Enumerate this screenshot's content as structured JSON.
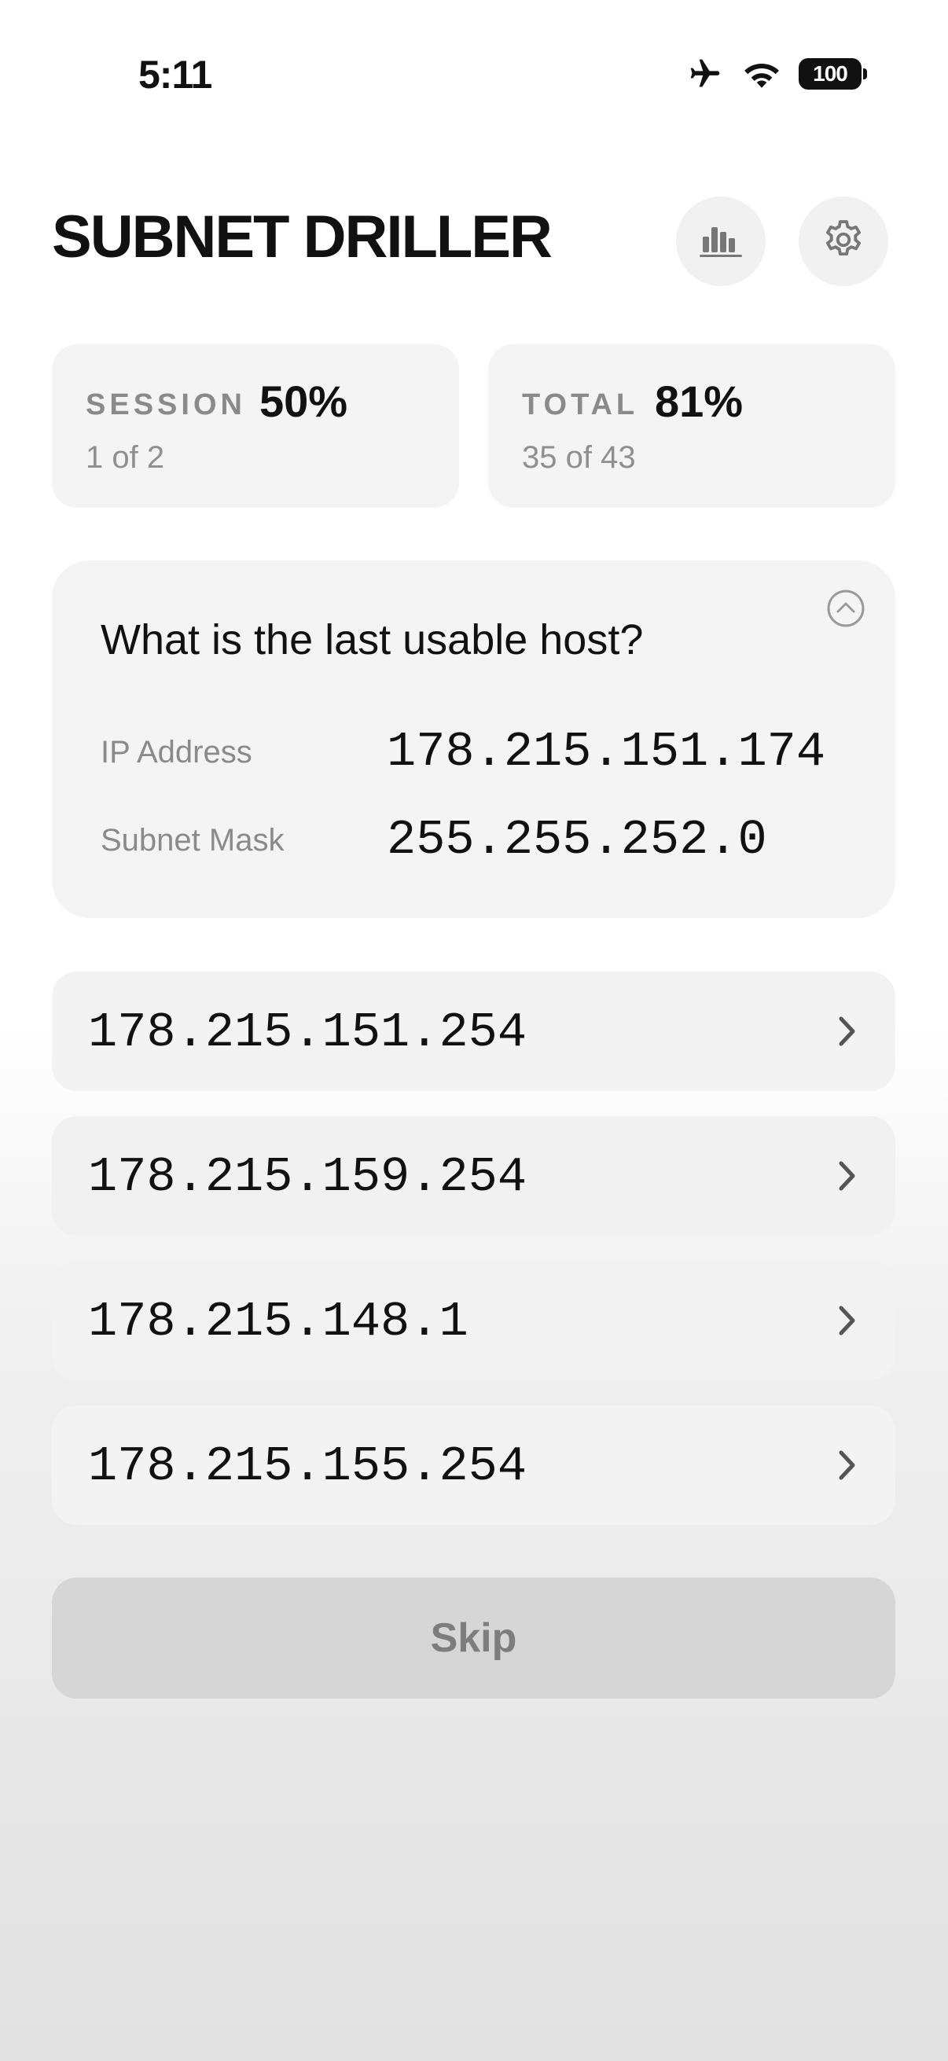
{
  "status_bar": {
    "time": "5:11",
    "battery": "100",
    "icons": [
      "airplane-icon",
      "wifi-icon",
      "battery-icon"
    ]
  },
  "header": {
    "title": "SUBNET DRILLER",
    "buttons": [
      "stats-icon",
      "gear-icon"
    ]
  },
  "scores": {
    "session": {
      "label": "SESSION",
      "percent": "50%",
      "detail": "1 of 2"
    },
    "total": {
      "label": "TOTAL",
      "percent": "81%",
      "detail": "35 of 43"
    }
  },
  "question": {
    "prompt": "What is the last usable host?",
    "ip_label": "IP Address",
    "ip_value": "178.215.151.174",
    "mask_label": "Subnet Mask",
    "mask_value": "255.255.252.0"
  },
  "options": [
    {
      "text": "178.215.151.254"
    },
    {
      "text": "178.215.159.254"
    },
    {
      "text": "178.215.148.1"
    },
    {
      "text": "178.215.155.254"
    }
  ],
  "skip_label": "Skip",
  "colors": {
    "card": "#f4f4f4",
    "muted_text": "#8a8a8a",
    "skip_bg": "#d6d6d6"
  }
}
